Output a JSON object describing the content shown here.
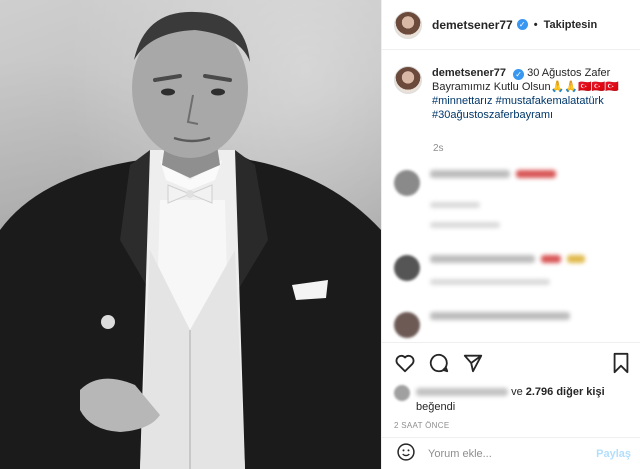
{
  "post": {
    "username": "demetsener77",
    "follow_status": "Takiptesin",
    "separator": "•",
    "caption_text": "30 Ağustos Zafer Bayramımız Kutlu Olsun🙏🙏🇹🇷🇹🇷🇹🇷",
    "hashtags": [
      "#minnettarız",
      "#mustafakemalatatürk",
      "#30ağustoszaferbayramı"
    ],
    "caption_time": "2s"
  },
  "likes": {
    "and_text": "ve",
    "count": "2.796 diğer kişi",
    "liked_text": "beğendi"
  },
  "post_age": "2 SAAT ÖNCE",
  "comment_box": {
    "placeholder": "Yorum ekle...",
    "post_label": "Paylaş"
  },
  "colors": {
    "verified": "#3897f0",
    "hashtag": "#00376b",
    "muted": "#8e8e8e",
    "post_disabled": "#b2dffc"
  },
  "icons": [
    "heart-icon",
    "comment-icon",
    "share-icon",
    "bookmark-icon",
    "emoji-icon",
    "verified-icon"
  ]
}
